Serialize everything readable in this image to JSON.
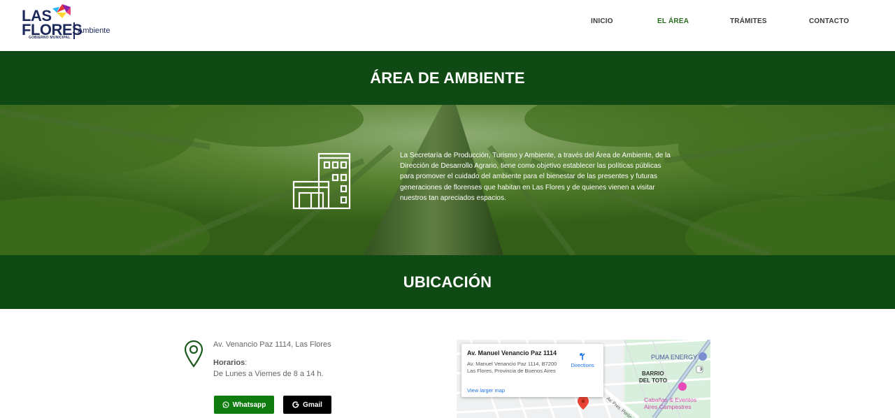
{
  "header": {
    "logo": {
      "line1": "LAS",
      "line2": "FLORES",
      "subtitle": "GOBIERNO MUNICIPAL",
      "section": "Ambiente"
    },
    "nav": [
      {
        "label": "INICIO",
        "active": false
      },
      {
        "label": "EL ÁREA",
        "active": true
      },
      {
        "label": "TRÁMITES",
        "active": false
      },
      {
        "label": "CONTACTO",
        "active": false
      }
    ]
  },
  "area_title": "ÁREA DE AMBIENTE",
  "hero": {
    "icon": "building-icon",
    "text": "La Secretaría de Producción, Turismo y Ambiente, a través del Área de Ambiente, de la Dirección de Desarrollo Agrario, tiene como objetivo establecer las políticas públicas para promover el cuidado del ambiente para el bienestar de las presentes y futuras generaciones de florenses que habitan en Las Flores y de quienes vienen a visitar nuestros tan apreciados espacios."
  },
  "location_title": "UBICACIÓN",
  "location": {
    "address": "Av. Venancio Paz 1114, Las Flores",
    "hours_label": "Horarios",
    "hours": "De Lunes a Viernes de 8 a 14 h.",
    "buttons": {
      "whatsapp": "Whatsapp",
      "gmail": "Gmail"
    }
  },
  "map": {
    "card_title": "Av. Manuel Venancio Paz 1114",
    "card_address": "Av. Manuel Venancio Paz 1114, B7200 Las Flores, Provincia de Buenos Aires",
    "directions": "Directions",
    "larger_map": "View larger map",
    "labels": {
      "puma": "PUMA ENERGY",
      "barrio_line1": "BARRIO",
      "barrio_line2": "DEL TOTO",
      "poi_line1": "Cabañas & Eventos",
      "poi_line2": "Aires Campestres",
      "street": "Av. Pres. Perón",
      "route": "3"
    }
  },
  "colors": {
    "band_green": "#0f4a14",
    "nav_active": "#2a6a1e",
    "whatsapp": "#107c10",
    "gmail": "#000000",
    "logo_navy": "#1f2a5c"
  }
}
